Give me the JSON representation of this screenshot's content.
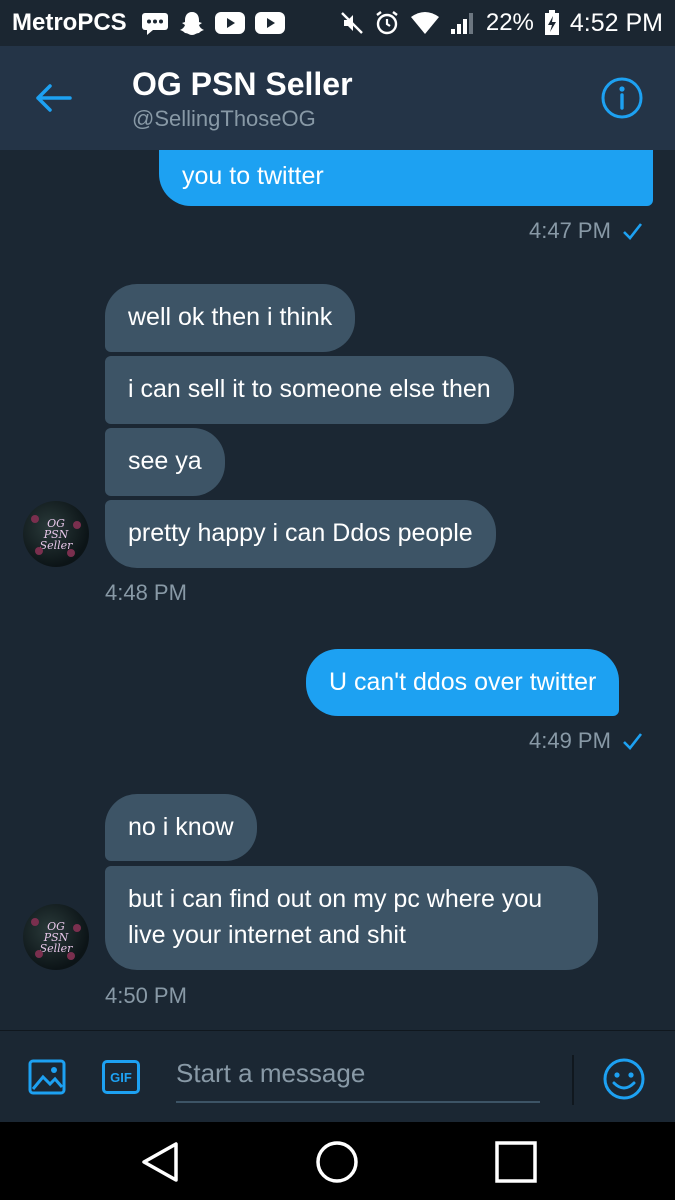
{
  "status_bar": {
    "carrier": "MetroPCS",
    "battery": "22%",
    "time": "4:52 PM"
  },
  "header": {
    "title": "OG PSN Seller",
    "handle": "@SellingThoseOG"
  },
  "messages": [
    {
      "side": "out",
      "text": "you to twitter"
    },
    {
      "side": "out_meta",
      "text": "4:47 PM"
    },
    {
      "side": "in",
      "text": "well ok then i think"
    },
    {
      "side": "in",
      "text": "i can sell it to someone else then"
    },
    {
      "side": "in",
      "text": "see ya"
    },
    {
      "side": "in",
      "text": "pretty happy i can Ddos people"
    },
    {
      "side": "in_meta",
      "text": "4:48 PM"
    },
    {
      "side": "out",
      "text": "U can't ddos over twitter"
    },
    {
      "side": "out_meta",
      "text": "4:49 PM"
    },
    {
      "side": "in",
      "text": "no i know"
    },
    {
      "side": "in",
      "text": "but i can find out on my pc where you live your internet and shit"
    },
    {
      "side": "in_meta",
      "text": "4:50 PM"
    }
  ],
  "avatar": {
    "lines": [
      "OG",
      "PSN",
      "Seller"
    ]
  },
  "composer": {
    "gif_label": "GIF",
    "placeholder": "Start a message"
  },
  "colors": {
    "accent": "#1da1f2",
    "incoming_bubble": "#3d5466",
    "background": "#1b2733",
    "header": "#243447",
    "muted_text": "#8899a6"
  },
  "icons": {
    "back": "arrow-left-icon",
    "info": "info-icon",
    "image": "image-icon",
    "gif": "gif-icon",
    "emoji": "emoji-icon",
    "nav_back": "triangle-back-icon",
    "nav_home": "circle-home-icon",
    "nav_recents": "square-recents-icon"
  }
}
